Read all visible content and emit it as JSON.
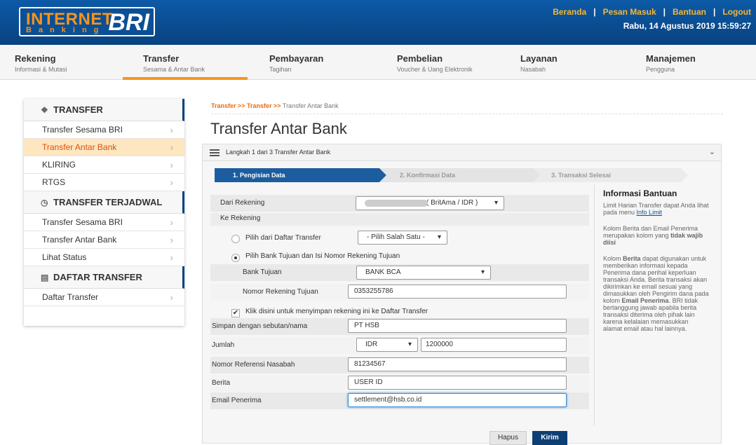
{
  "header": {
    "logo_top": "INTERNET",
    "logo_bottom": "Banking",
    "logo_brand": "BRI",
    "links": [
      "Beranda",
      "Pesan Masuk",
      "Bantuan",
      "Logout"
    ],
    "datetime": "Rabu, 14 Agustus 2019 15:59:27"
  },
  "nav": [
    {
      "t": "Rekening",
      "s": "Informasi & Mutasi"
    },
    {
      "t": "Transfer",
      "s": "Sesama & Antar Bank"
    },
    {
      "t": "Pembayaran",
      "s": "Tagihan"
    },
    {
      "t": "Pembelian",
      "s": "Voucher & Uang Elektronik"
    },
    {
      "t": "Layanan",
      "s": "Nasabah"
    },
    {
      "t": "Manajemen",
      "s": "Pengguna"
    }
  ],
  "sidebar": {
    "h1": "TRANSFER",
    "g1": [
      "Transfer Sesama BRI",
      "Transfer Antar Bank",
      "KLIRING",
      "RTGS"
    ],
    "h2": "TRANSFER TERJADWAL",
    "g2": [
      "Transfer Sesama BRI",
      "Transfer Antar Bank",
      "Lihat Status"
    ],
    "h3": "DAFTAR TRANSFER",
    "g3": [
      "Daftar Transfer"
    ]
  },
  "crumb": {
    "a": "Transfer >> Transfer >>",
    "b": " Transfer Antar Bank"
  },
  "title": "Transfer Antar Bank",
  "step_label": "Langkah 1 dari 3 Transfer Antar Bank",
  "progress": [
    "1. Pengisian Data",
    "2. Konfirmasi Data",
    "3. Transaksi Selesai"
  ],
  "form": {
    "dari_label": "Dari Rekening",
    "dari_value": "( BritAma / IDR )",
    "ke_label": "Ke Rekening",
    "opt1_label": "Pilih dari Daftar Transfer",
    "opt1_select": "- Pilih Salah Satu -",
    "opt2_label": "Pilih Bank Tujuan dan Isi Nomor Rekening Tujuan",
    "bank_label": "Bank Tujuan",
    "bank_value": "BANK BCA",
    "norek_label": "Nomor Rekening Tujuan",
    "norek_value": "0353255786",
    "save_label": "Klik disini untuk menyimpan rekening ini ke Daftar Transfer",
    "nama_label": "Simpan dengan sebutan/nama",
    "nama_value": "PT HSB",
    "jumlah_label": "Jumlah",
    "currency": "IDR",
    "jumlah_value": "1200000",
    "ref_label": "Nomor Referensi Nasabah",
    "ref_value": "81234567",
    "berita_label": "Berita",
    "berita_value": "USER ID",
    "email_label": "Email Penerima",
    "email_value": "settlement@hsb.co.id"
  },
  "info": {
    "title": "Informasi Bantuan",
    "p1": "Limit Harian Transfer dapat Anda lihat pada menu ",
    "p1_link": "Info Limit",
    "p2a": "Kolom Berita dan Email Penerima merupakan kolom yang ",
    "p2b": "tidak wajib diisi",
    "p3a": "Kolom ",
    "p3b": "Berita",
    "p3c": " dapat digunakan untuk memberikan informasi kepada Penerima dana perihal keperluan transaksi Anda. Berita transaksi akan dikirimkan ke email sesuai yang dimasukkan oleh Pengirim dana pada kolom ",
    "p3d": "Email Penerima",
    "p3e": ". BRI tidak bertanggung jawab apabila berita transaksi diterima oleh pihak lain karena kelalaian memasukkan alamat email atau hal lainnya."
  },
  "buttons": {
    "hapus": "Hapus",
    "kirim": "Kirim"
  }
}
